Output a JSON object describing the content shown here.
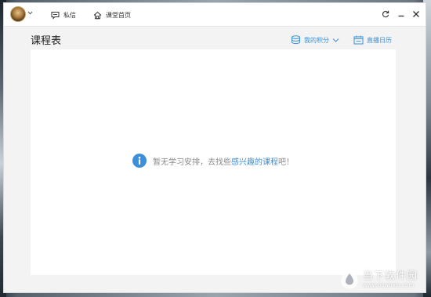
{
  "titlebar": {
    "messages_label": "私信",
    "home_label": "课堂首页"
  },
  "page": {
    "title": "课程表"
  },
  "toolbar": {
    "points_label": "我的积分",
    "calendar_label": "直播日历"
  },
  "empty_state": {
    "prefix": "暂无学习安排，去找些",
    "link": "感兴趣的课程",
    "suffix": "吧！"
  },
  "watermark": {
    "cn": "当下软件园",
    "en": "www.downxia.com"
  },
  "colors": {
    "accent": "#3a8fd9",
    "info_icon": "#3d8fdc",
    "muted_text": "#8a8a8a"
  },
  "icons": {
    "messages": "message-icon",
    "home": "home-icon",
    "points": "coins-icon",
    "calendar": "calendar-icon",
    "refresh": "refresh-icon",
    "minimize": "minimize-icon",
    "close": "close-icon",
    "info": "info-icon"
  }
}
